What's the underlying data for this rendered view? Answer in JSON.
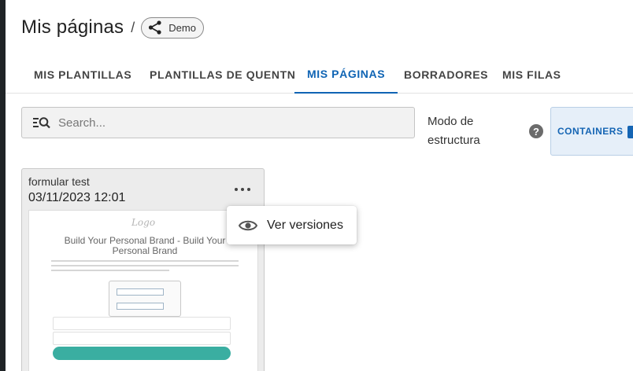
{
  "header": {
    "title": "Mis páginas",
    "separator": "/",
    "share_chip_label": "Demo",
    "share_icon": "share-icon"
  },
  "tabs": [
    {
      "label": "MIS PLANTILLAS",
      "active": false
    },
    {
      "label": "PLANTILLAS DE QUENTN",
      "active": false
    },
    {
      "label": "MIS PÁGINAS",
      "active": true
    },
    {
      "label": "BORRADORES",
      "active": false
    },
    {
      "label": "MIS FILAS",
      "active": false
    }
  ],
  "search": {
    "placeholder": "Search...",
    "value": "",
    "icon": "filter-search-icon"
  },
  "mode": {
    "label": "Modo de estructura",
    "help_icon": "help-icon",
    "button_label": "CONTAINERS"
  },
  "card": {
    "name": "formular test",
    "date": "03/11/2023 12:01",
    "more_icon": "more-horizontal-icon",
    "preview": {
      "logo_text": "Logo",
      "heading": "Build Your Personal Brand - Build Your Personal Brand"
    }
  },
  "context_menu": {
    "items": [
      {
        "label": "Ver versiones",
        "icon": "eye-icon"
      }
    ]
  },
  "colors": {
    "accent": "#0f64b4",
    "containers_bg": "#e6eff9",
    "preview_button": "#3aaea1"
  }
}
